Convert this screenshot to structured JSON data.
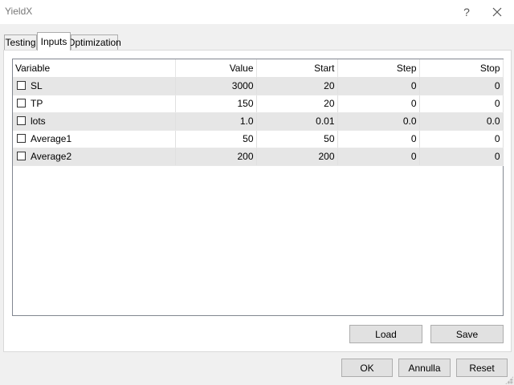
{
  "window": {
    "title": "YieldX",
    "help_label": "?"
  },
  "tabs": [
    {
      "label": "Testing"
    },
    {
      "label": "Inputs",
      "selected": true
    },
    {
      "label": "Optimization"
    }
  ],
  "grid": {
    "columns": [
      "Variable",
      "Value",
      "Start",
      "Step",
      "Stop"
    ],
    "rows": [
      {
        "checked": false,
        "variable": "SL",
        "value": "3000",
        "start": "20",
        "step": "0",
        "stop": "0"
      },
      {
        "checked": false,
        "variable": "TP",
        "value": "150",
        "start": "20",
        "step": "0",
        "stop": "0"
      },
      {
        "checked": false,
        "variable": "lots",
        "value": "1.0",
        "start": "0.01",
        "step": "0.0",
        "stop": "0.0"
      },
      {
        "checked": false,
        "variable": "Average1",
        "value": "50",
        "start": "50",
        "step": "0",
        "stop": "0"
      },
      {
        "checked": false,
        "variable": "Average2",
        "value": "200",
        "start": "200",
        "step": "0",
        "stop": "0"
      }
    ]
  },
  "panel_buttons": {
    "load": "Load",
    "save": "Save"
  },
  "dialog_buttons": {
    "ok": "OK",
    "cancel": "Annulla",
    "reset": "Reset"
  },
  "colors": {
    "row_alt": "#e6e6e6",
    "panel_bg": "#ffffff",
    "dialog_bg": "#f0f0f0"
  }
}
